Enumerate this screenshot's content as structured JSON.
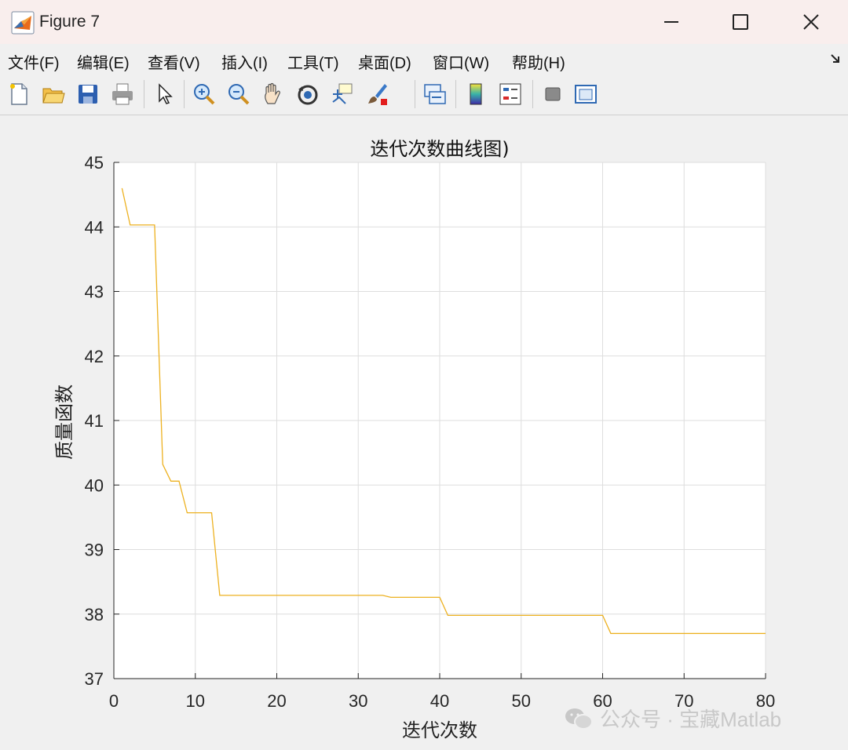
{
  "window": {
    "title": "Figure 7",
    "icon": "matlab-icon"
  },
  "menu": {
    "items": [
      "文件(F)",
      "编辑(E)",
      "查看(V)",
      "插入(I)",
      "工具(T)",
      "桌面(D)",
      "窗口(W)",
      "帮助(H)"
    ]
  },
  "toolbar": {
    "buttons": [
      "new-figure-icon",
      "open-file-icon",
      "save-icon",
      "print-icon",
      "pointer-icon",
      "zoom-in-icon",
      "zoom-out-icon",
      "pan-icon",
      "rotate-3d-icon",
      "data-cursor-icon",
      "brush-icon",
      "link-plot-icon",
      "colorbar-icon",
      "legend-icon",
      "hide-plot-tools-icon",
      "show-plot-tools-icon"
    ]
  },
  "chart_data": {
    "type": "line",
    "title": "迭代次数曲线图)",
    "xlabel": "迭代次数",
    "ylabel": "质量函数",
    "xlim": [
      0,
      80
    ],
    "ylim": [
      37,
      45
    ],
    "xticks": [
      0,
      10,
      20,
      30,
      40,
      50,
      60,
      70,
      80
    ],
    "yticks": [
      37,
      38,
      39,
      40,
      41,
      42,
      43,
      44,
      45
    ],
    "grid": true,
    "series": [
      {
        "color": "#edb120",
        "x": [
          1,
          2,
          5,
          6,
          7,
          8,
          9,
          12,
          13,
          33,
          34,
          40,
          41,
          60,
          61,
          80
        ],
        "y": [
          44.6,
          44.03,
          44.03,
          40.32,
          40.06,
          40.06,
          39.57,
          39.57,
          38.29,
          38.29,
          38.26,
          38.26,
          37.98,
          37.98,
          37.7,
          37.7
        ]
      }
    ]
  },
  "watermark": {
    "text": "公众号 · 宝藏Matlab"
  }
}
